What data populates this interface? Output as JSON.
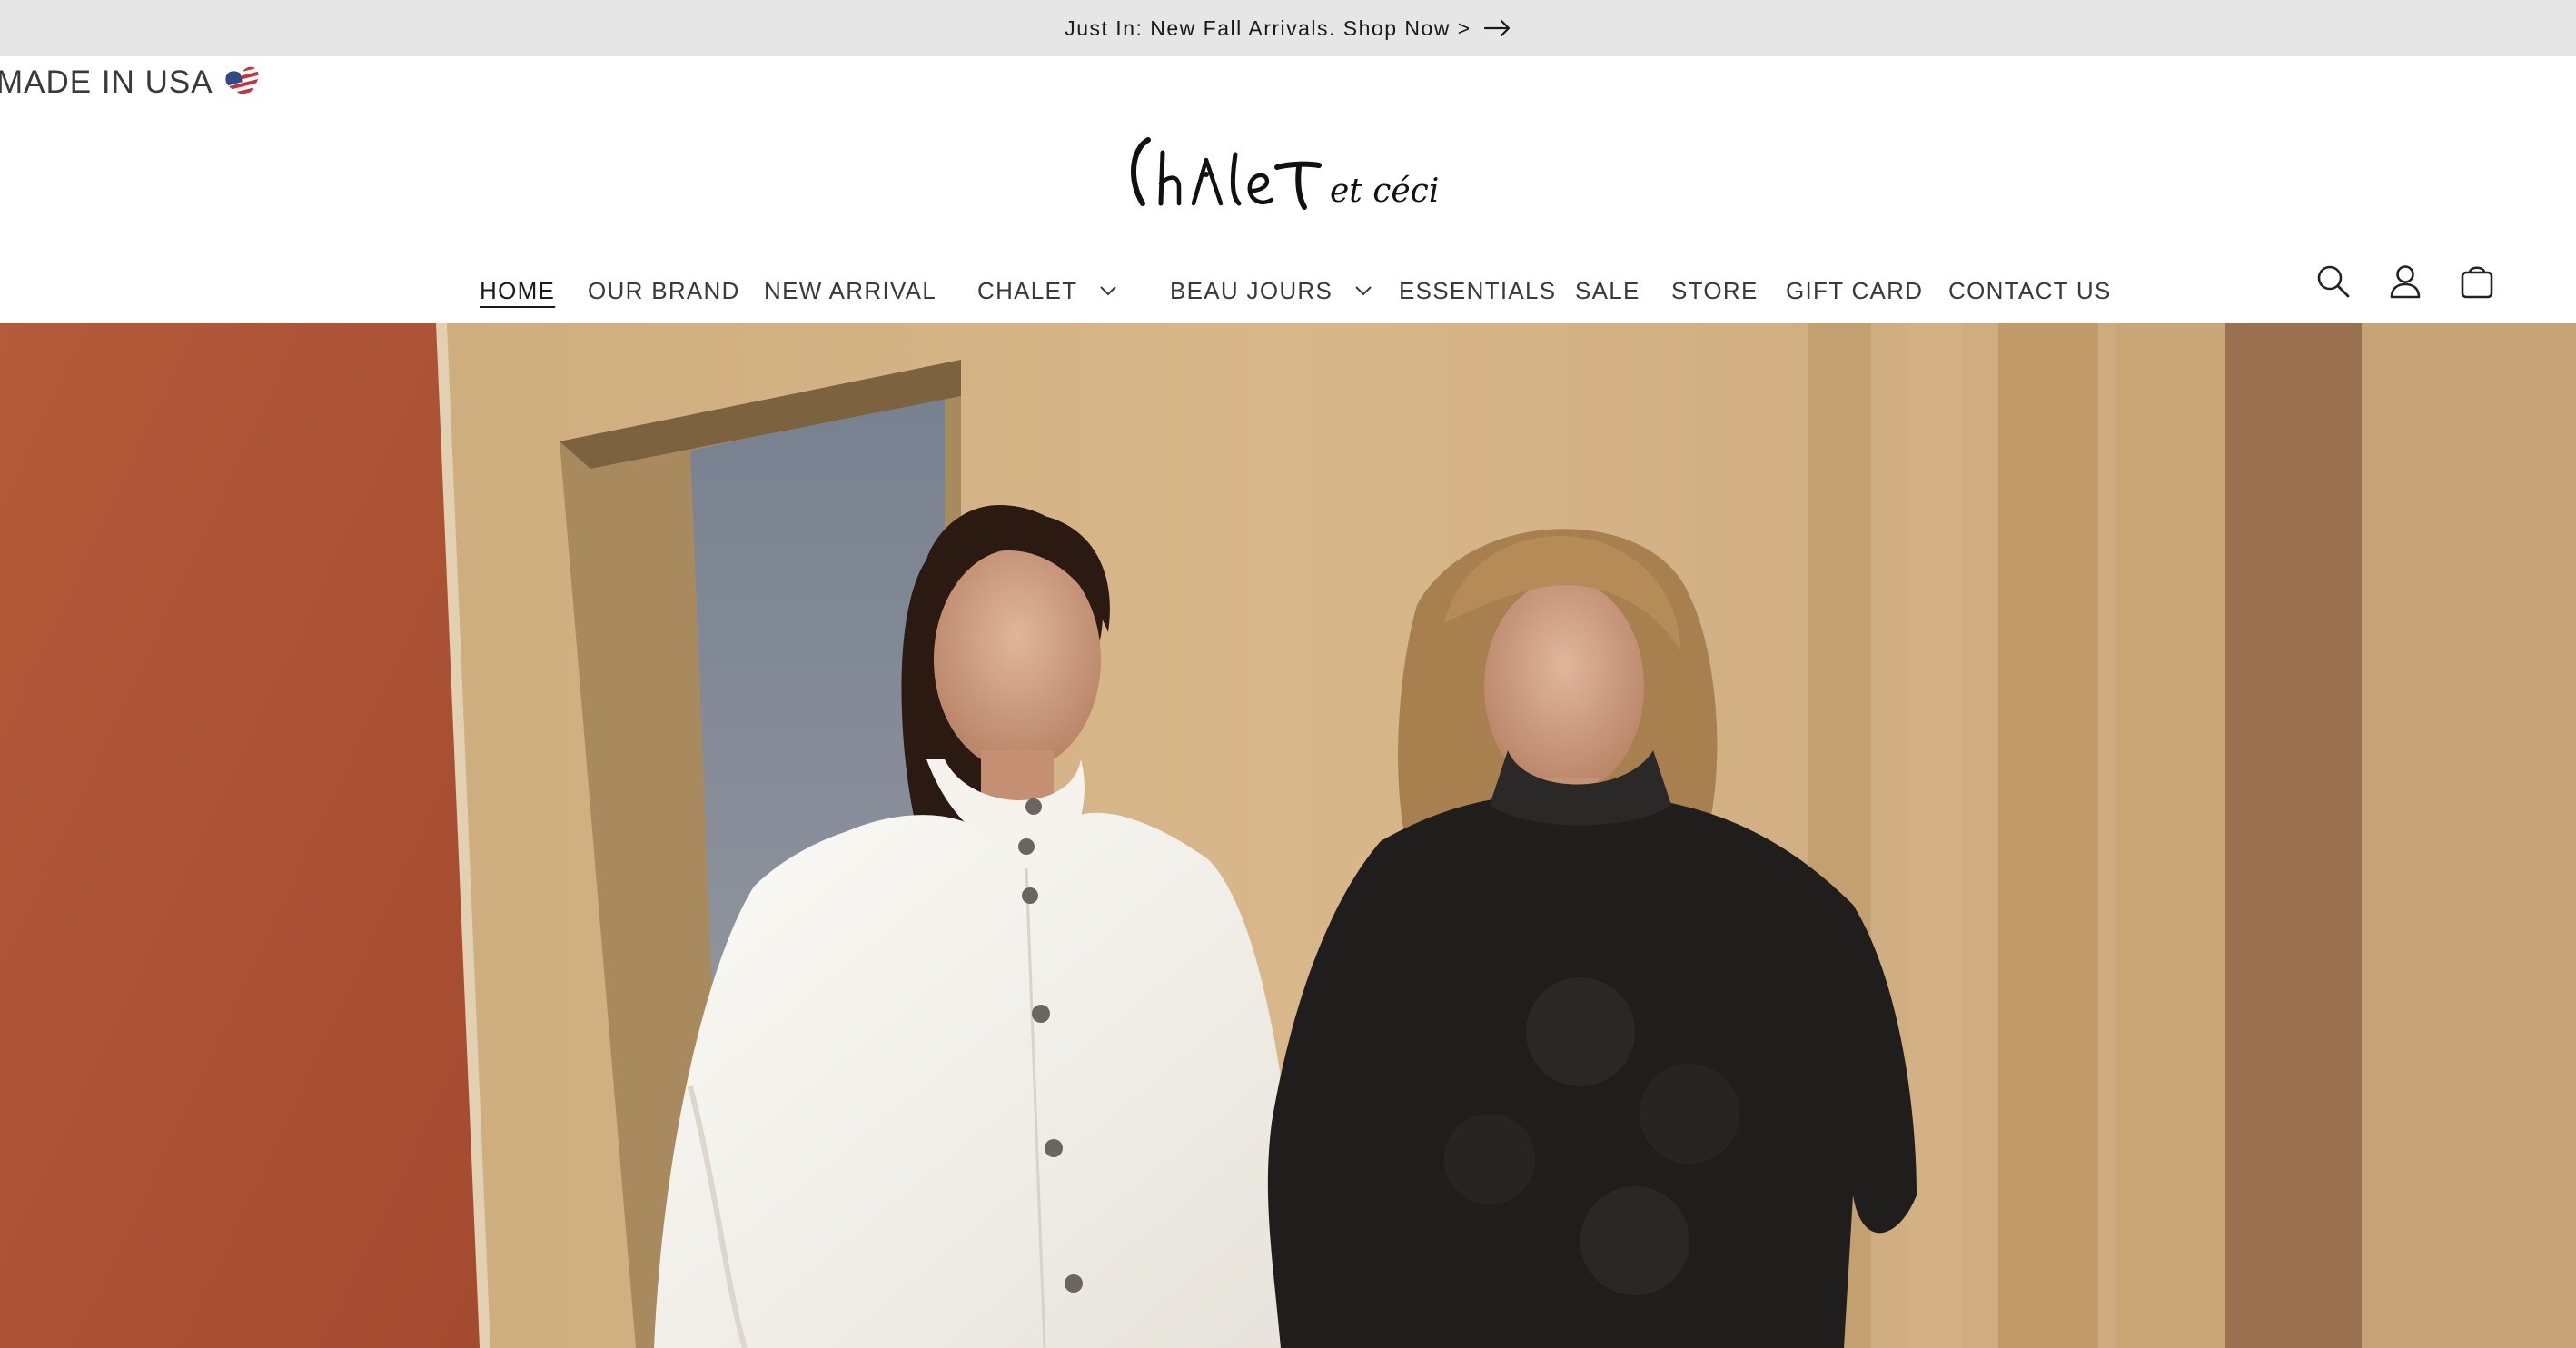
{
  "announcement": {
    "text": "Just In: New Fall Arrivals. Shop Now >",
    "icon": "arrow-right-icon"
  },
  "badge": {
    "text": "MADE IN USA",
    "icon": "us-flag-heart-icon"
  },
  "logo": {
    "text": "Chalet et céci"
  },
  "nav": {
    "items": [
      {
        "label": "HOME",
        "active": true
      },
      {
        "label": "OUR BRAND"
      },
      {
        "label": "NEW ARRIVAL"
      },
      {
        "label": "CHALET",
        "dropdown": true
      },
      {
        "label": "BEAU JOURS",
        "dropdown": true
      },
      {
        "label": "ESSENTIALS"
      },
      {
        "label": "SALE"
      },
      {
        "label": "STORE"
      },
      {
        "label": "GIFT CARD"
      },
      {
        "label": "CONTACT US"
      }
    ]
  },
  "header_icons": [
    "search-icon",
    "account-icon",
    "cart-icon"
  ],
  "colors": {
    "announcement_bg": "#e6e6e6",
    "text": "#333333",
    "hero_wall": "#cfae82",
    "hero_terracotta": "#b5583a"
  }
}
